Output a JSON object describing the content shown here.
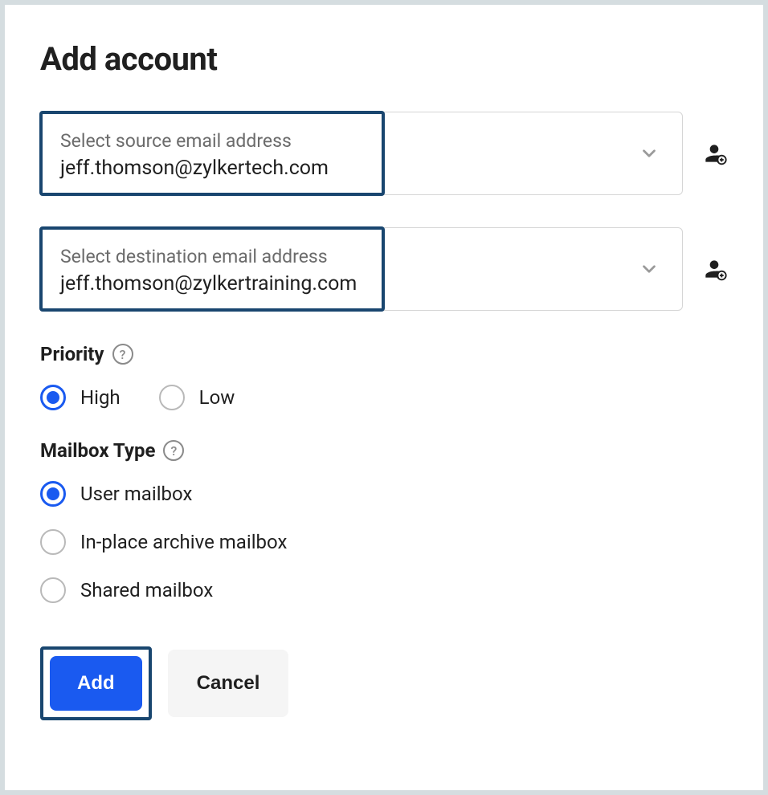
{
  "title": "Add account",
  "source": {
    "label": "Select source email address",
    "value": "jeff.thomson@zylkertech.com"
  },
  "destination": {
    "label": "Select destination email address",
    "value": "jeff.thomson@zylkertraining.com"
  },
  "priority": {
    "label": "Priority",
    "options": {
      "high": "High",
      "low": "Low"
    },
    "selected": "high"
  },
  "mailbox_type": {
    "label": "Mailbox Type",
    "options": {
      "user": "User mailbox",
      "archive": "In-place archive mailbox",
      "shared": "Shared mailbox"
    },
    "selected": "user"
  },
  "buttons": {
    "add": "Add",
    "cancel": "Cancel"
  }
}
